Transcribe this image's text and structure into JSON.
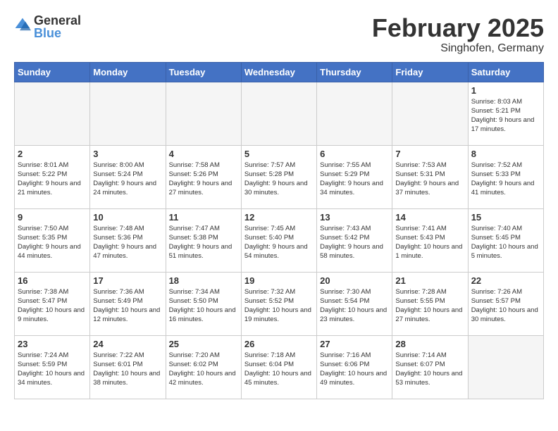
{
  "header": {
    "logo_general": "General",
    "logo_blue": "Blue",
    "month_title": "February 2025",
    "location": "Singhofen, Germany"
  },
  "days_of_week": [
    "Sunday",
    "Monday",
    "Tuesday",
    "Wednesday",
    "Thursday",
    "Friday",
    "Saturday"
  ],
  "weeks": [
    [
      {
        "day": "",
        "empty": true
      },
      {
        "day": "",
        "empty": true
      },
      {
        "day": "",
        "empty": true
      },
      {
        "day": "",
        "empty": true
      },
      {
        "day": "",
        "empty": true
      },
      {
        "day": "",
        "empty": true
      },
      {
        "day": "1",
        "sunrise": "8:03 AM",
        "sunset": "5:21 PM",
        "daylight": "9 hours and 17 minutes."
      }
    ],
    [
      {
        "day": "2",
        "sunrise": "8:01 AM",
        "sunset": "5:22 PM",
        "daylight": "9 hours and 21 minutes."
      },
      {
        "day": "3",
        "sunrise": "8:00 AM",
        "sunset": "5:24 PM",
        "daylight": "9 hours and 24 minutes."
      },
      {
        "day": "4",
        "sunrise": "7:58 AM",
        "sunset": "5:26 PM",
        "daylight": "9 hours and 27 minutes."
      },
      {
        "day": "5",
        "sunrise": "7:57 AM",
        "sunset": "5:28 PM",
        "daylight": "9 hours and 30 minutes."
      },
      {
        "day": "6",
        "sunrise": "7:55 AM",
        "sunset": "5:29 PM",
        "daylight": "9 hours and 34 minutes."
      },
      {
        "day": "7",
        "sunrise": "7:53 AM",
        "sunset": "5:31 PM",
        "daylight": "9 hours and 37 minutes."
      },
      {
        "day": "8",
        "sunrise": "7:52 AM",
        "sunset": "5:33 PM",
        "daylight": "9 hours and 41 minutes."
      }
    ],
    [
      {
        "day": "9",
        "sunrise": "7:50 AM",
        "sunset": "5:35 PM",
        "daylight": "9 hours and 44 minutes."
      },
      {
        "day": "10",
        "sunrise": "7:48 AM",
        "sunset": "5:36 PM",
        "daylight": "9 hours and 47 minutes."
      },
      {
        "day": "11",
        "sunrise": "7:47 AM",
        "sunset": "5:38 PM",
        "daylight": "9 hours and 51 minutes."
      },
      {
        "day": "12",
        "sunrise": "7:45 AM",
        "sunset": "5:40 PM",
        "daylight": "9 hours and 54 minutes."
      },
      {
        "day": "13",
        "sunrise": "7:43 AM",
        "sunset": "5:42 PM",
        "daylight": "9 hours and 58 minutes."
      },
      {
        "day": "14",
        "sunrise": "7:41 AM",
        "sunset": "5:43 PM",
        "daylight": "10 hours and 1 minute."
      },
      {
        "day": "15",
        "sunrise": "7:40 AM",
        "sunset": "5:45 PM",
        "daylight": "10 hours and 5 minutes."
      }
    ],
    [
      {
        "day": "16",
        "sunrise": "7:38 AM",
        "sunset": "5:47 PM",
        "daylight": "10 hours and 9 minutes."
      },
      {
        "day": "17",
        "sunrise": "7:36 AM",
        "sunset": "5:49 PM",
        "daylight": "10 hours and 12 minutes."
      },
      {
        "day": "18",
        "sunrise": "7:34 AM",
        "sunset": "5:50 PM",
        "daylight": "10 hours and 16 minutes."
      },
      {
        "day": "19",
        "sunrise": "7:32 AM",
        "sunset": "5:52 PM",
        "daylight": "10 hours and 19 minutes."
      },
      {
        "day": "20",
        "sunrise": "7:30 AM",
        "sunset": "5:54 PM",
        "daylight": "10 hours and 23 minutes."
      },
      {
        "day": "21",
        "sunrise": "7:28 AM",
        "sunset": "5:55 PM",
        "daylight": "10 hours and 27 minutes."
      },
      {
        "day": "22",
        "sunrise": "7:26 AM",
        "sunset": "5:57 PM",
        "daylight": "10 hours and 30 minutes."
      }
    ],
    [
      {
        "day": "23",
        "sunrise": "7:24 AM",
        "sunset": "5:59 PM",
        "daylight": "10 hours and 34 minutes."
      },
      {
        "day": "24",
        "sunrise": "7:22 AM",
        "sunset": "6:01 PM",
        "daylight": "10 hours and 38 minutes."
      },
      {
        "day": "25",
        "sunrise": "7:20 AM",
        "sunset": "6:02 PM",
        "daylight": "10 hours and 42 minutes."
      },
      {
        "day": "26",
        "sunrise": "7:18 AM",
        "sunset": "6:04 PM",
        "daylight": "10 hours and 45 minutes."
      },
      {
        "day": "27",
        "sunrise": "7:16 AM",
        "sunset": "6:06 PM",
        "daylight": "10 hours and 49 minutes."
      },
      {
        "day": "28",
        "sunrise": "7:14 AM",
        "sunset": "6:07 PM",
        "daylight": "10 hours and 53 minutes."
      },
      {
        "day": "",
        "empty": true
      }
    ]
  ]
}
